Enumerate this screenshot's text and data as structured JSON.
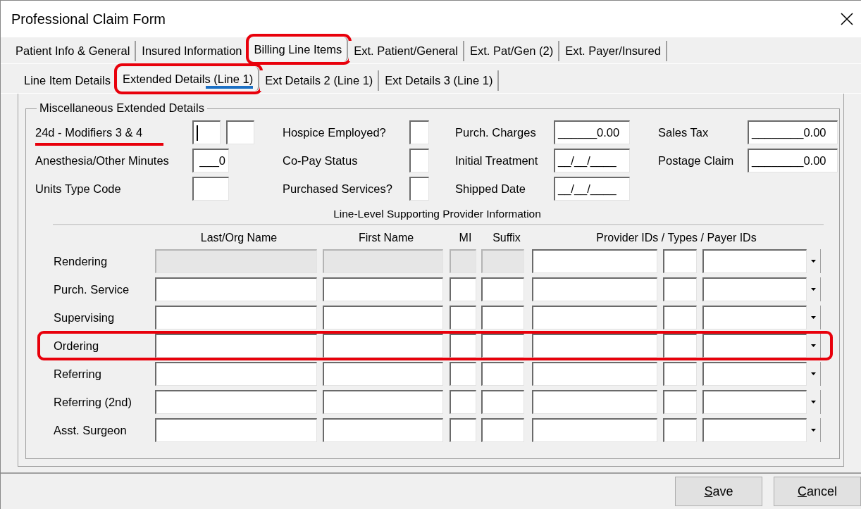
{
  "window": {
    "title": "Professional Claim Form"
  },
  "tabs": [
    {
      "label": "Patient Info & General",
      "selected": false,
      "highlighted": false
    },
    {
      "label": "Insured Information",
      "selected": false,
      "highlighted": false
    },
    {
      "label": "Billing Line Items",
      "selected": true,
      "highlighted": true
    },
    {
      "label": "Ext. Patient/General",
      "selected": false,
      "highlighted": false
    },
    {
      "label": "Ext. Pat/Gen (2)",
      "selected": false,
      "highlighted": false
    },
    {
      "label": "Ext. Payer/Insured",
      "selected": false,
      "highlighted": false
    }
  ],
  "subtabs": [
    {
      "label": "Line Item Details",
      "selected": false,
      "highlighted": false,
      "underlined": false
    },
    {
      "label": "Extended Details (Line 1)",
      "selected": true,
      "highlighted": true,
      "underlined": true
    },
    {
      "label": "Ext Details 2 (Line 1)",
      "selected": false,
      "highlighted": false,
      "underlined": false
    },
    {
      "label": "Ext Details 3 (Line 1)",
      "selected": false,
      "highlighted": false,
      "underlined": false
    }
  ],
  "group": {
    "title": "Miscellaneous Extended Details",
    "rows": [
      [
        {
          "label": "24d - Modifiers 3 & 4",
          "kind": "pair",
          "underlined": true,
          "focused": true
        },
        {
          "label": "Hospice Employed?",
          "kind": "flag",
          "underlined": false
        },
        {
          "label": "Purch. Charges",
          "kind": "text",
          "value": "______0.00",
          "underlined": false
        },
        {
          "label": "Sales Tax",
          "kind": "wide",
          "value": "________0.00",
          "underlined": false
        }
      ],
      [
        {
          "label": "Anesthesia/Other Minutes",
          "kind": "short",
          "value": "___0",
          "underlined": false
        },
        {
          "label": "Co-Pay Status",
          "kind": "flag",
          "underlined": false
        },
        {
          "label": "Initial Treatment",
          "kind": "text",
          "value": "__/__/____",
          "underlined": false
        },
        {
          "label": "Postage Claim",
          "kind": "wide",
          "value": "________0.00",
          "underlined": false
        }
      ],
      [
        {
          "label": "Units Type Code",
          "kind": "short",
          "underlined": false
        },
        {
          "label": "Purchased Services?",
          "kind": "flag",
          "underlined": false
        },
        {
          "label": "Shipped Date",
          "kind": "text",
          "value": "__/__/____",
          "underlined": false
        }
      ]
    ],
    "provider": {
      "title": "Line-Level Supporting Provider Information",
      "columns": [
        "Last/Org Name",
        "First Name",
        "MI",
        "Suffix",
        "Provider IDs / Types / Payer IDs"
      ],
      "rows": [
        {
          "label": "Rendering",
          "disabled": true,
          "highlighted": false
        },
        {
          "label": "Purch. Service",
          "disabled": false,
          "highlighted": false
        },
        {
          "label": "Supervising",
          "disabled": false,
          "highlighted": false
        },
        {
          "label": "Ordering",
          "disabled": false,
          "highlighted": true
        },
        {
          "label": "Referring",
          "disabled": false,
          "highlighted": false
        },
        {
          "label": "Referring (2nd)",
          "disabled": false,
          "highlighted": false
        },
        {
          "label": "Asst. Surgeon",
          "disabled": false,
          "highlighted": false
        }
      ]
    }
  },
  "buttons": [
    {
      "mnemonic": "S",
      "rest": "ave"
    },
    {
      "mnemonic": "C",
      "rest": "ancel"
    }
  ]
}
